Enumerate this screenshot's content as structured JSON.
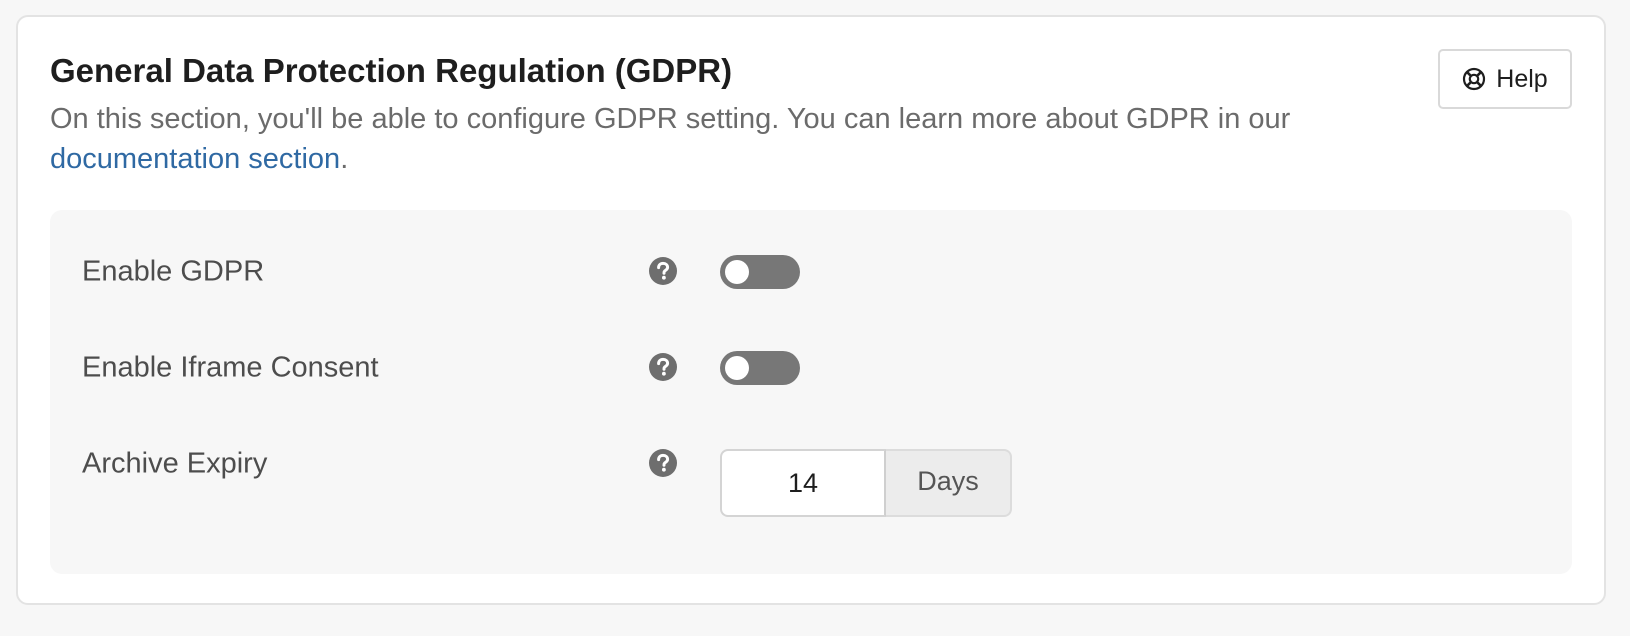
{
  "section": {
    "title": "General Data Protection Regulation (GDPR)",
    "description_prefix": "On this section, you'll be able to configure GDPR setting. You can learn more about GDPR in our ",
    "doc_link_text": "documentation section",
    "description_suffix": ".",
    "help_button_label": "Help",
    "help_button_icon": "lifebuoy-icon"
  },
  "settings": {
    "enable_gdpr": {
      "label": "Enable GDPR",
      "enabled": false,
      "help_icon": "question-circle-icon"
    },
    "enable_iframe_consent": {
      "label": "Enable Iframe Consent",
      "enabled": false,
      "help_icon": "question-circle-icon"
    },
    "archive_expiry": {
      "label": "Archive Expiry",
      "value": "14",
      "unit": "Days",
      "help_icon": "question-circle-icon"
    }
  },
  "colors": {
    "link": "#2f69a3",
    "toggle_off": "#777777",
    "panel_bg": "#f7f7f7"
  }
}
